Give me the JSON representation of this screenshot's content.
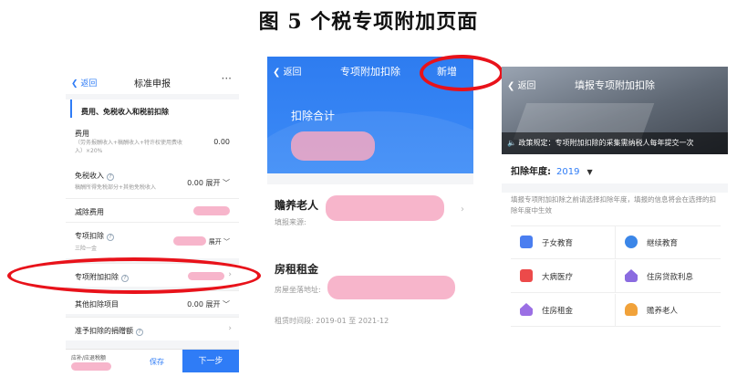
{
  "figure_title": "图 5  个税专项附加页面",
  "screen1": {
    "back_label": "返回",
    "title": "标准申报",
    "more": "···",
    "section_header": "费用、免税收入和税前扣除",
    "expense": {
      "label": "费用",
      "sub": "（劳务报酬收入+稿酬收入+特许权使用费收入）×20%",
      "value": "0.00"
    },
    "tax_free": {
      "label": "免税收入",
      "sub": "稿酬所得免税部分+其他免税收入",
      "value": "0.00 展开"
    },
    "reduce_expense": {
      "label": "减除费用"
    },
    "special_deduction": {
      "label": "专项扣除",
      "sub": "三险一金",
      "expand": "展开"
    },
    "special_additional": {
      "label": "专项附加扣除"
    },
    "other_deduction": {
      "label": "其他扣除项目",
      "value": "0.00 展开"
    },
    "donation": {
      "label": "准予扣除的捐赠额"
    },
    "bottom": {
      "refund_label": "应补/应退税额",
      "save": "保存",
      "next": "下一步"
    }
  },
  "screen2": {
    "back_label": "返回",
    "title": "专项附加扣除",
    "add_button": "新增",
    "total_label": "扣除合计",
    "elderly": {
      "title": "赡养老人",
      "source_label": "填报来源:"
    },
    "rent": {
      "title": "房租租金",
      "address_label": "房屋坐落地址:",
      "period": "租赁时间段: 2019-01 至 2021-12"
    }
  },
  "screen3": {
    "back_label": "返回",
    "title": "填报专项附加扣除",
    "notice": "政策规定：专项附加扣除的采集需纳税人每年提交一次",
    "year_label": "扣除年度:",
    "year_value": "2019",
    "hint": "填报专项附加扣除之前请选择扣除年度，填报的信息将会在选择的扣除年度中生效",
    "items": [
      {
        "label": "子女教育",
        "icon": "books-icon",
        "color": "#4a7ef0"
      },
      {
        "label": "继续教育",
        "icon": "graduation-cap-icon",
        "color": "#3b86e8"
      },
      {
        "label": "大病医疗",
        "icon": "medical-kit-icon",
        "color": "#ec4a4a"
      },
      {
        "label": "住房贷款利息",
        "icon": "house-loan-icon",
        "color": "#8a6be0"
      },
      {
        "label": "住房租金",
        "icon": "house-rent-icon",
        "color": "#9b6fe4"
      },
      {
        "label": "赡养老人",
        "icon": "elderly-person-icon",
        "color": "#f1a23a"
      }
    ]
  }
}
